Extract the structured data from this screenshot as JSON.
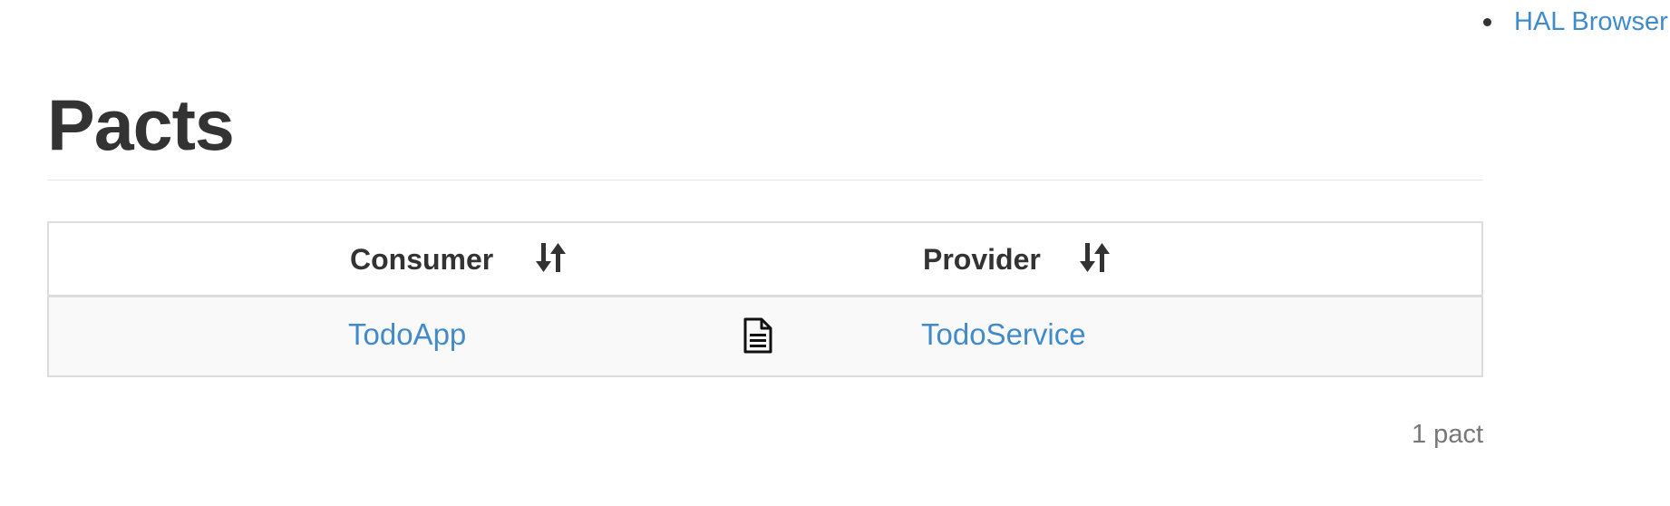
{
  "nav": {
    "items": [
      {
        "label": "HAL Browser"
      }
    ]
  },
  "page": {
    "title": "Pacts"
  },
  "table": {
    "columns": [
      {
        "label": "Consumer",
        "sort_icon": "sort-arrows-icon"
      },
      {
        "label": "",
        "icon": ""
      },
      {
        "label": "Provider",
        "sort_icon": "sort-arrows-icon"
      }
    ],
    "rows": [
      {
        "consumer": "TodoApp",
        "doc_icon": "document-icon",
        "provider": "TodoService"
      }
    ]
  },
  "footer": {
    "count_text": "1 pact"
  },
  "colors": {
    "link": "#428bca",
    "text": "#333333",
    "muted": "#777777",
    "border": "#dddddd",
    "row_striped": "#f9f9f9"
  }
}
